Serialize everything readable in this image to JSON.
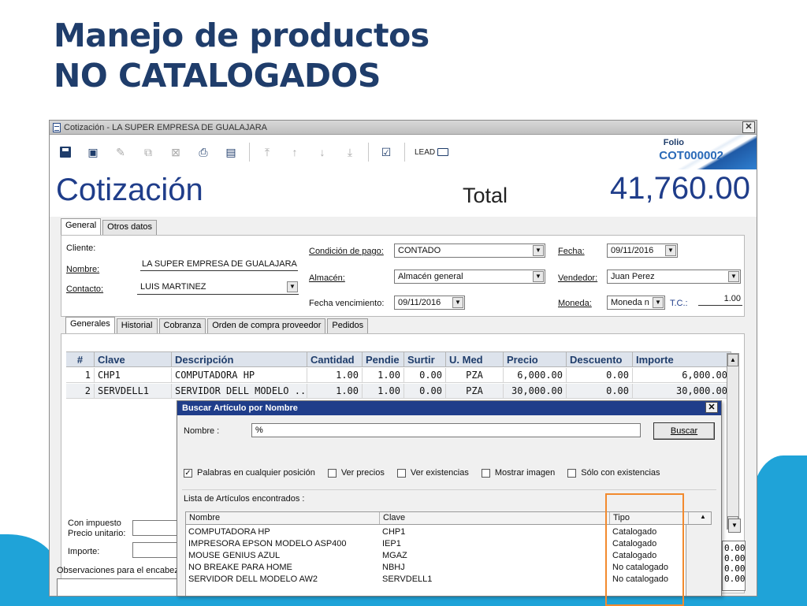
{
  "slide": {
    "title_line1": "Manejo de productos",
    "title_line2": "NO CATALOGADOS"
  },
  "window": {
    "title": "Cotización - LA SUPER EMPRESA DE GUALAJARA",
    "close": "✕"
  },
  "toolbar": {
    "lead_label": "LEAD",
    "folio_label": "Folio",
    "folio_value": "COT000002"
  },
  "header": {
    "doc_title": "Cotización",
    "total_label": "Total",
    "total_value": "41,760.00"
  },
  "tabs_top": [
    "General",
    "Otros datos"
  ],
  "form": {
    "cliente_label": "Cliente:",
    "nombre_label": "Nombre:",
    "nombre_value": "LA SUPER EMPRESA DE GUALAJARA",
    "contacto_label": "Contacto:",
    "contacto_value": "LUIS MARTINEZ",
    "condicion_label": "Condición de pago:",
    "condicion_value": "CONTADO",
    "almacen_label": "Almacén:",
    "almacen_value": "Almacén general",
    "fecha_venc_label": "Fecha vencimiento:",
    "fecha_venc_value": "09/11/2016",
    "fecha_label": "Fecha:",
    "fecha_value": "09/11/2016",
    "vendedor_label": "Vendedor:",
    "vendedor_value": "Juan Perez",
    "moneda_label": "Moneda:",
    "moneda_value": "Moneda n",
    "tc_label": "T.C.:",
    "tc_value": "1.00"
  },
  "tabs_mid": [
    "Generales",
    "Historial",
    "Cobranza",
    "Orden de compra proveedor",
    "Pedidos"
  ],
  "grid": {
    "headers": [
      "#",
      "Clave",
      "Descripción",
      "Cantidad",
      "Pendie",
      "Surtir",
      "U. Med",
      "Precio",
      "Descuento",
      "Importe"
    ],
    "rows": [
      [
        "1",
        "CHP1",
        "COMPUTADORA HP",
        "1.00",
        "1.00",
        "0.00",
        "PZA",
        "6,000.00",
        "0.00",
        "6,000.00"
      ],
      [
        "2",
        "SERVDELL1",
        "SERVIDOR DELL MODELO ...",
        "1.00",
        "1.00",
        "0.00",
        "PZA",
        "30,000.00",
        "0.00",
        "30,000.00"
      ]
    ]
  },
  "bottom": {
    "con_impuesto": "Con impuesto",
    "precio_unitario": "Precio unitario:",
    "importe": "Importe:",
    "observaciones": "Observaciones para el encabez",
    "right_values": [
      "0.00",
      "0.00",
      "0.00",
      "0.00"
    ]
  },
  "dialog": {
    "title": "Buscar Artículo por Nombre",
    "close": "✕",
    "nombre_label": "Nombre :",
    "nombre_value": "%",
    "buscar_label": "Buscar",
    "checks": [
      {
        "label": "Palabras en cualquier posición",
        "checked": true
      },
      {
        "label": "Ver precios",
        "checked": false
      },
      {
        "label": "Ver existencias",
        "checked": false
      },
      {
        "label": "Mostrar imagen",
        "checked": false
      },
      {
        "label": "Sólo con existencias",
        "checked": false
      }
    ],
    "list_label": "Lista de Artículos encontrados :",
    "list_headers": [
      "Nombre",
      "Clave",
      "Tipo"
    ],
    "list_rows": [
      [
        "COMPUTADORA HP",
        "CHP1",
        "Catalogado"
      ],
      [
        "IMPRESORA EPSON MODELO ASP400",
        "IEP1",
        "Catalogado"
      ],
      [
        "MOUSE GENIUS AZUL",
        "MGAZ",
        "Catalogado"
      ],
      [
        "NO BREAKE PARA HOME",
        "NBHJ",
        "No catalogado"
      ],
      [
        "SERVIDOR DELL MODELO AW2",
        "SERVDELL1",
        "No catalogado"
      ]
    ]
  },
  "colors": {
    "title_blue": "#1f3d6b",
    "accent_cyan": "#1fa3d8",
    "highlight_orange": "#f28a2e",
    "dialog_title_bg": "#1f3d8a"
  }
}
